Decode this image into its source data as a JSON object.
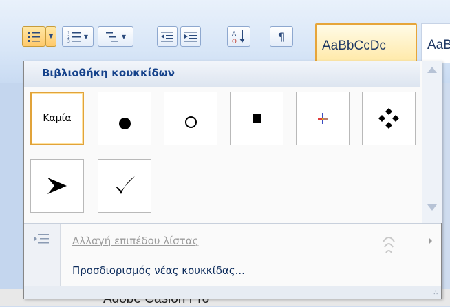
{
  "ribbon": {
    "bullets_button": "bullets",
    "numbering_button": "numbering",
    "multilevel_button": "multilevel-list",
    "decrease_indent": "decrease-indent",
    "increase_indent": "increase-indent",
    "sort_button": "sort",
    "show_marks_button": "¶",
    "styles": [
      {
        "label": "AaBbCcDc"
      },
      {
        "label": "AaB"
      }
    ]
  },
  "popup": {
    "title": "Βιβλιοθήκη κουκκίδων",
    "bullets": [
      {
        "id": "none",
        "label": "Καμία",
        "selected": true
      },
      {
        "id": "disc",
        "label": ""
      },
      {
        "id": "circle",
        "label": ""
      },
      {
        "id": "square",
        "label": ""
      },
      {
        "id": "color-cross",
        "label": ""
      },
      {
        "id": "diamond-cluster",
        "label": ""
      },
      {
        "id": "arrowhead",
        "label": ""
      },
      {
        "id": "checkmark",
        "label": ""
      }
    ],
    "menu": {
      "change_level": "Αλλαγή επιπέδου λίστας",
      "define_new": "Προσδιορισμός νέας κουκκίδας..."
    }
  },
  "document": {
    "text": "Adobe Caslon Pro"
  },
  "colors": {
    "accent_selected": "#e1a33a",
    "title_blue": "#15428b",
    "ribbon_bg": "#d8e6f7"
  }
}
